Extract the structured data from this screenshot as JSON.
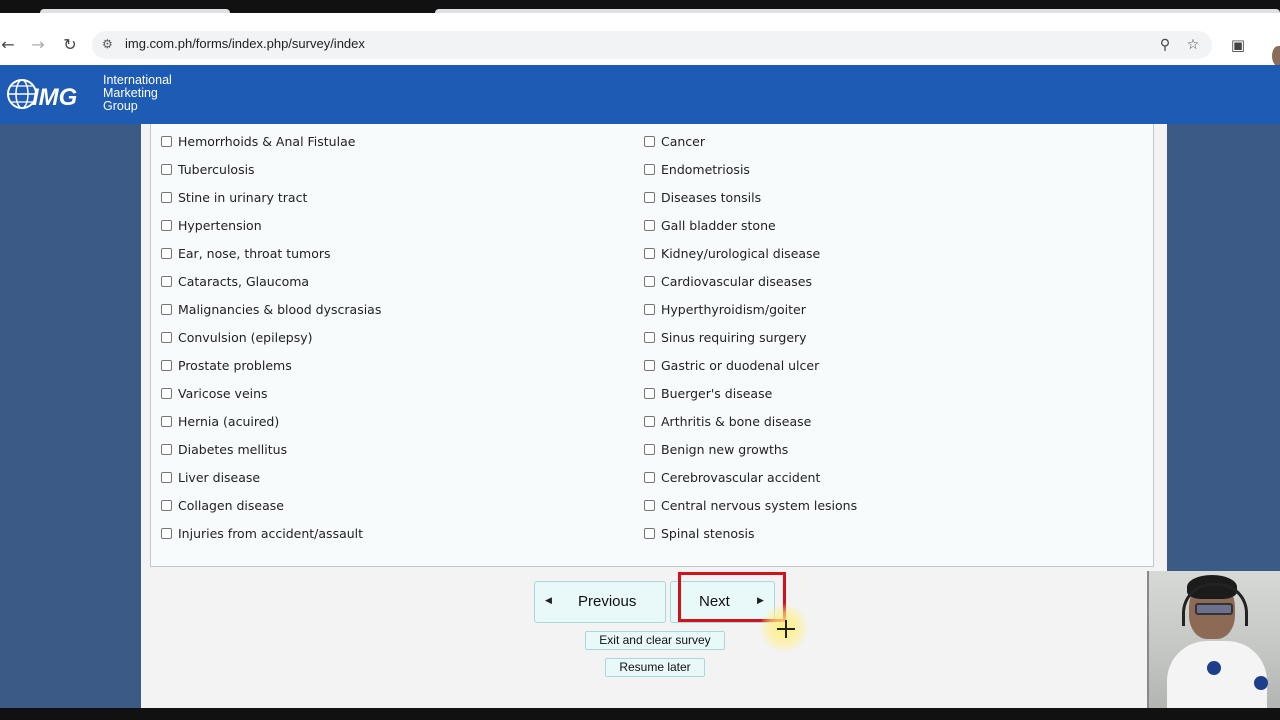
{
  "browser": {
    "url": "img.com.ph/forms/index.php/survey/index",
    "back_icon": "arrow-left-icon",
    "forward_icon": "arrow-right-icon",
    "reload_icon": "reload-icon",
    "site_settings_icon": "tune-icon",
    "zoom_icon": "zoom-icon",
    "bookmark_icon": "star-icon",
    "extensions_icon": "puzzle-icon"
  },
  "header": {
    "logo_text": "IMG",
    "brand_line1": "International",
    "brand_line2": "Marketing",
    "brand_line3": "Group",
    "color": "#1d5bb5"
  },
  "conditions": {
    "left": [
      "Hemorrhoids & Anal Fistulae",
      "Tuberculosis",
      "Stine in urinary tract",
      "Hypertension",
      "Ear, nose, throat tumors",
      "Cataracts, Glaucoma",
      "Malignancies & blood dyscrasias",
      "Convulsion (epilepsy)",
      "Prostate problems",
      "Varicose veins",
      "Hernia (acuired)",
      "Diabetes mellitus",
      "Liver disease",
      "Collagen disease",
      "Injuries from accident/assault"
    ],
    "right": [
      "Cancer",
      "Endometriosis",
      "Diseases tonsils",
      "Gall bladder stone",
      "Kidney/urological disease",
      "Cardiovascular diseases",
      "Hyperthyroidism/goiter",
      "Sinus requiring surgery",
      "Gastric or duodenal ulcer",
      "Buerger's disease",
      "Arthritis & bone disease",
      "Benign new growths",
      "Cerebrovascular accident",
      "Central nervous system lesions",
      "Spinal stenosis"
    ]
  },
  "nav": {
    "previous_label": "Previous",
    "next_label": "Next",
    "exit_label": "Exit and clear survey",
    "resume_label": "Resume later",
    "highlight_color": "#d4101b"
  }
}
